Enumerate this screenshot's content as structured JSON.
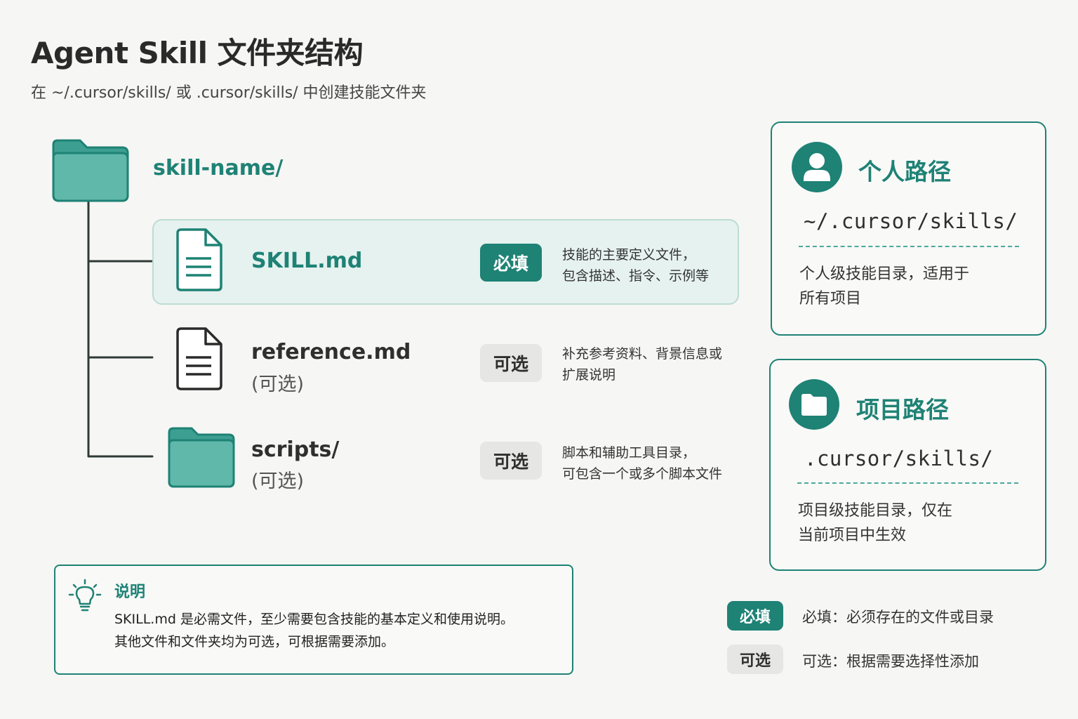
{
  "header": {
    "title": "Agent Skill 文件夹结构",
    "subtitle": "在 ~/.cursor/skills/ 或 .cursor/skills/ 中创建技能文件夹"
  },
  "tree": {
    "root": {
      "name": "skill-name/",
      "icon": "folder-icon"
    },
    "items": [
      {
        "name": "SKILL.md",
        "sub": "",
        "icon": "document-icon",
        "badge": "必填",
        "desc_line1": "技能的主要定义文件，",
        "desc_line2": "包含描述、指令、示例等"
      },
      {
        "name": "reference.md",
        "sub": "(可选)",
        "icon": "document-icon",
        "badge": "可选",
        "desc_line1": "补充参考资料、背景信息或",
        "desc_line2": "扩展说明"
      },
      {
        "name": "scripts/",
        "sub": "(可选)",
        "icon": "folder-icon",
        "badge": "可选",
        "desc_line1": "脚本和辅助工具目录，",
        "desc_line2": "可包含一个或多个脚本文件"
      }
    ]
  },
  "paths": {
    "personal": {
      "icon": "user-icon",
      "title": "个人路径",
      "code": "~/.cursor/skills/",
      "desc_line1": "个人级技能目录，适用于",
      "desc_line2": "所有项目"
    },
    "project": {
      "icon": "folder-icon",
      "title": "项目路径",
      "code": ".cursor/skills/",
      "desc_line1": "项目级技能目录，仅在",
      "desc_line2": "当前项目中生效"
    }
  },
  "note": {
    "icon": "lightbulb-icon",
    "title": "说明",
    "line1": "SKILL.md 是必需文件，至少需要包含技能的基本定义和使用说明。",
    "line2": "其他文件和文件夹均为可选，可根据需要添加。"
  },
  "legend": {
    "required_badge": "必填",
    "required_text": "必填：必须存在的文件或目录",
    "optional_badge": "可选",
    "optional_text": "可选：根据需要选择性添加"
  },
  "colors": {
    "accent": "#1e8275",
    "folder": "#5fb8aa",
    "folder_dark": "#1e8275",
    "card_bg": "#e6f2ef",
    "optional_badge_bg": "#e6e6e4"
  }
}
